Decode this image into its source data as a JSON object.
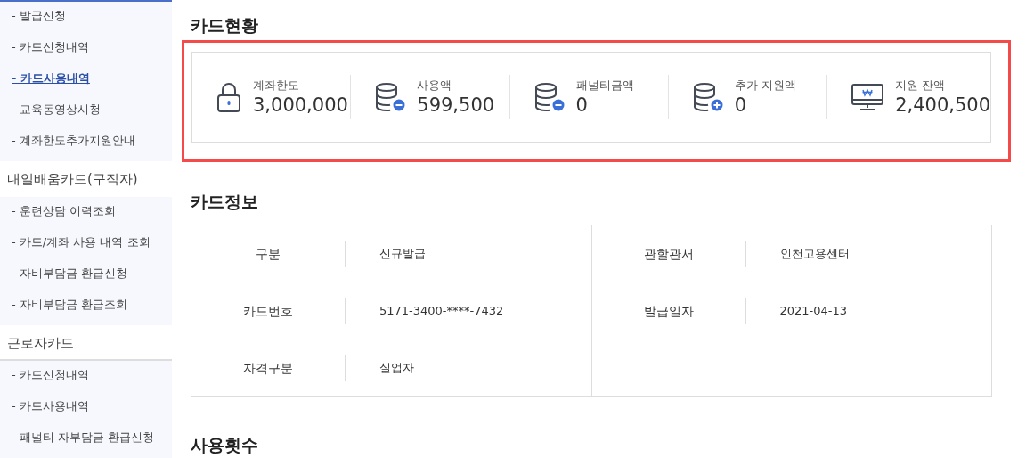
{
  "sidebar": {
    "groups": [
      {
        "items": [
          {
            "label": "- 발급신청",
            "selected": false
          },
          {
            "label": "- 카드신청내역",
            "selected": false
          },
          {
            "label": "- 카드사용내역",
            "selected": true
          },
          {
            "label": "- 교육동영상시청",
            "selected": false
          },
          {
            "label": "- 계좌한도추가지원안내",
            "selected": false
          }
        ]
      },
      {
        "title": "내일배움카드(구직자)",
        "items": [
          {
            "label": "- 훈련상담 이력조회",
            "selected": false
          },
          {
            "label": "- 카드/계좌 사용 내역 조회",
            "selected": false
          },
          {
            "label": "- 자비부담금 환급신청",
            "selected": false
          },
          {
            "label": "- 자비부담금 환급조회",
            "selected": false
          }
        ]
      },
      {
        "title": "근로자카드",
        "items": [
          {
            "label": "- 카드신청내역",
            "selected": false
          },
          {
            "label": "- 카드사용내역",
            "selected": false
          },
          {
            "label": "- 패널티 자부담금 환급신청",
            "selected": false
          }
        ]
      }
    ]
  },
  "card_status": {
    "title": "카드현황",
    "highlighted": true,
    "stats": [
      {
        "kind": "lock",
        "label": "계좌한도",
        "value": "3,000,000"
      },
      {
        "kind": "minus",
        "label": "사용액",
        "value": "599,500"
      },
      {
        "kind": "minus",
        "label": "패널티금액",
        "value": "0"
      },
      {
        "kind": "plus",
        "label": "추가 지원액",
        "value": "0"
      },
      {
        "kind": "monitor",
        "label": "지원 잔액",
        "value": "2,400,500"
      }
    ]
  },
  "card_info": {
    "title": "카드정보",
    "rows": [
      [
        {
          "label": "구분",
          "value": "신규발급"
        },
        {
          "label": "관할관서",
          "value": "인천고용센터"
        }
      ],
      [
        {
          "label": "카드번호",
          "value": "5171-3400-****-7432"
        },
        {
          "label": "발급일자",
          "value": "2021-04-13"
        }
      ],
      [
        {
          "label": "자격구분",
          "value": "실업자"
        }
      ]
    ]
  },
  "next_section": {
    "title": "사용횟수"
  }
}
